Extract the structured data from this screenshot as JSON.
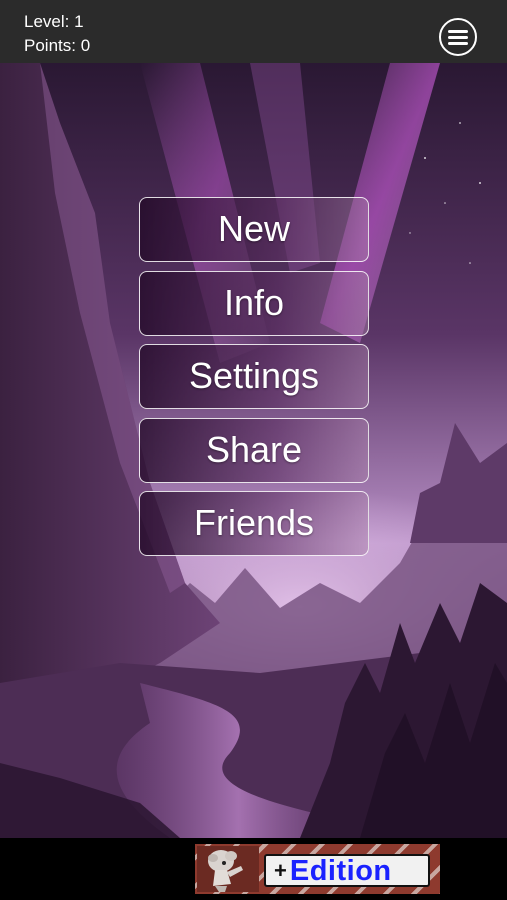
{
  "status": {
    "level_label": "Level: 1",
    "points_label": "Points: 0"
  },
  "header": {
    "menu_icon": "hamburger-menu-icon"
  },
  "main_menu": {
    "items": [
      {
        "label": "New"
      },
      {
        "label": "Info"
      },
      {
        "label": "Settings"
      },
      {
        "label": "Share"
      },
      {
        "label": "Friends"
      }
    ]
  },
  "ad_banner": {
    "plus": "+",
    "edition": "Edition",
    "mascot_icon": "cartoon-mascot-icon",
    "edition_color": "#1a22ff"
  },
  "colors": {
    "topbar": "#2b2b2b",
    "scene_tint": "#8c4f9a"
  }
}
